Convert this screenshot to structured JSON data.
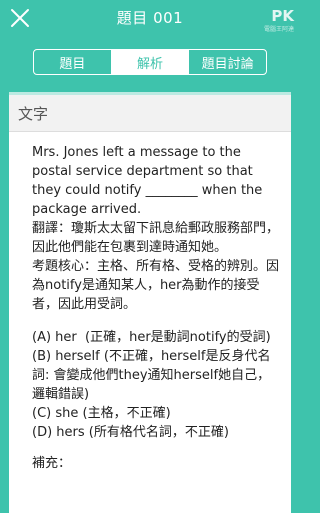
{
  "header": {
    "title": "題目 001",
    "watermark_logo": "PK",
    "watermark_sub": "電腦王阿達"
  },
  "tabs": [
    {
      "label": "題目",
      "active": false
    },
    {
      "label": "解析",
      "active": true
    },
    {
      "label": "題目討論",
      "active": false
    }
  ],
  "card": {
    "section_title": "文字",
    "question": "Mrs. Jones left a message to the postal service department so that they could notify ________ when the package arrived.",
    "translation": "翻譯：瓊斯太太留下訊息給郵政服務部門，因此他們能在包裹到達時通知她。",
    "core": "考題核心：主格、所有格、受格的辨別。因為notify是通知某人，her為動作的接受者，因此用受詞。",
    "options": [
      "(A) her  (正確，her是動詞notify的受詞)",
      "(B) herself (不正確，herself是反身代名詞: 會變成他們they通知herself她自己，邏輯錯誤)",
      "(C) she (主格，不正確)",
      "(D) hers (所有格代名詞，不正確)"
    ],
    "supplement": "補充："
  },
  "colors": {
    "accent": "#3ec3ac",
    "card_header_bg": "#f2f2f2",
    "text": "#222222"
  },
  "icons": {
    "close": "close-icon"
  }
}
